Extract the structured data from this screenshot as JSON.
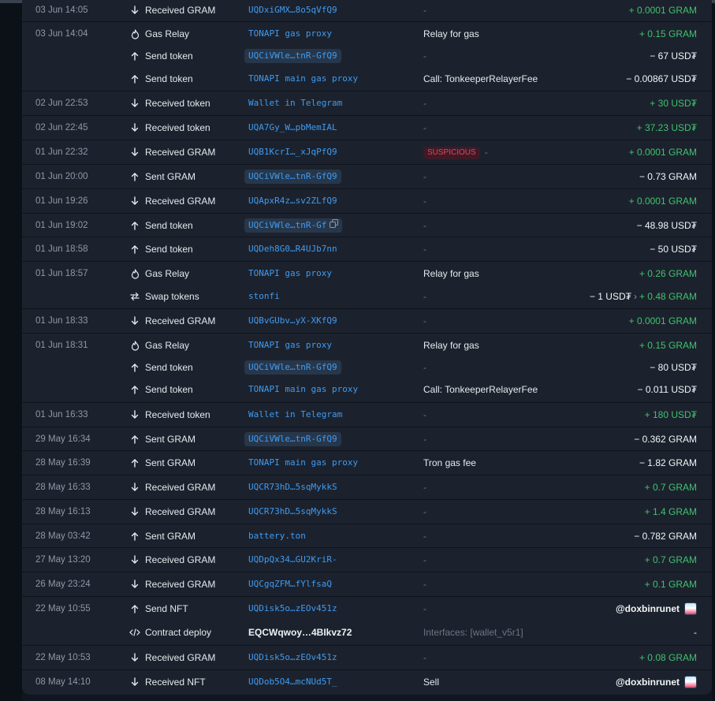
{
  "transactions": [
    {
      "date": "03 Jun 14:05",
      "icon": "arrow-down-icon",
      "type": "Received GRAM",
      "address": "UQDxiGMX…8o5qVfQ9",
      "addr_style": "plain",
      "description": "-",
      "amount": "+ 0.0001 GRAM",
      "amount_kind": "pos"
    },
    {
      "date": "03 Jun 14:04",
      "icon": "flame-icon",
      "type": "Gas Relay",
      "address": "TONAPI gas proxy",
      "addr_style": "plain",
      "description": "Relay for gas",
      "amount": "+ 0.15 GRAM",
      "amount_kind": "pos"
    },
    {
      "date": "",
      "icon": "arrow-up-icon",
      "type": "Send token",
      "address": "UQCiVWle…tnR-GfQ9",
      "addr_style": "pill",
      "description": "-",
      "amount": "− 67 USD₮",
      "amount_kind": "neg"
    },
    {
      "date": "",
      "icon": "arrow-up-icon",
      "type": "Send token",
      "address": "TONAPI main gas proxy",
      "addr_style": "plain",
      "description": "Call: TonkeeperRelayerFee",
      "amount": "− 0.00867 USD₮",
      "amount_kind": "neg"
    },
    {
      "date": "02 Jun 22:53",
      "icon": "arrow-down-icon",
      "type": "Received token",
      "address": "Wallet in Telegram",
      "addr_style": "plain",
      "description": "-",
      "amount": "+ 30 USD₮",
      "amount_kind": "pos"
    },
    {
      "date": "02 Jun 22:45",
      "icon": "arrow-down-icon",
      "type": "Received token",
      "address": "UQA7Gy_W…pbMemIAL",
      "addr_style": "plain",
      "description": "-",
      "amount": "+ 37.23 USD₮",
      "amount_kind": "pos"
    },
    {
      "date": "01 Jun 22:32",
      "icon": "arrow-down-icon",
      "type": "Received GRAM",
      "address": "UQB1KcrI…_xJqPfQ9",
      "addr_style": "plain",
      "description": "SUSPICIOUS",
      "desc_style": "badge",
      "amount": "+ 0.0001 GRAM",
      "amount_kind": "pos"
    },
    {
      "date": "01 Jun 20:00",
      "icon": "arrow-up-icon",
      "type": "Sent GRAM",
      "address": "UQCiVWle…tnR-GfQ9",
      "addr_style": "pill",
      "description": "-",
      "amount": "− 0.73 GRAM",
      "amount_kind": "neg"
    },
    {
      "date": "01 Jun 19:26",
      "icon": "arrow-down-icon",
      "type": "Received GRAM",
      "address": "UQApxR4z…sv2ZLfQ9",
      "addr_style": "plain",
      "description": "-",
      "amount": "+ 0.0001 GRAM",
      "amount_kind": "pos"
    },
    {
      "date": "01 Jun 19:02",
      "icon": "arrow-up-icon",
      "type": "Send token",
      "address": "UQCiVWle…tnR-Gf",
      "addr_style": "pill-copy",
      "description": "-",
      "amount": "− 48.98 USD₮",
      "amount_kind": "neg"
    },
    {
      "date": "01 Jun 18:58",
      "icon": "arrow-up-icon",
      "type": "Send token",
      "address": "UQDeh8G0…R4UJb7nn",
      "addr_style": "plain",
      "description": "-",
      "amount": "− 50 USD₮",
      "amount_kind": "neg"
    },
    {
      "date": "01 Jun 18:57",
      "icon": "flame-icon",
      "type": "Gas Relay",
      "address": "TONAPI gas proxy",
      "addr_style": "plain",
      "description": "Relay for gas",
      "amount": "+ 0.26 GRAM",
      "amount_kind": "pos"
    },
    {
      "date": "",
      "icon": "swap-icon",
      "type": "Swap tokens",
      "address": "stonfi",
      "addr_style": "plain",
      "description": "-",
      "amount_kind": "swap",
      "swap_out": "− 1 USD₮",
      "swap_in": "+ 0.48 GRAM"
    },
    {
      "date": "01 Jun 18:33",
      "icon": "arrow-down-icon",
      "type": "Received GRAM",
      "address": "UQBvGUbv…yX-XKfQ9",
      "addr_style": "plain",
      "description": "-",
      "amount": "+ 0.0001 GRAM",
      "amount_kind": "pos"
    },
    {
      "date": "01 Jun 18:31",
      "icon": "flame-icon",
      "type": "Gas Relay",
      "address": "TONAPI gas proxy",
      "addr_style": "plain",
      "description": "Relay for gas",
      "amount": "+ 0.15 GRAM",
      "amount_kind": "pos"
    },
    {
      "date": "",
      "icon": "arrow-up-icon",
      "type": "Send token",
      "address": "UQCiVWle…tnR-GfQ9",
      "addr_style": "pill",
      "description": "-",
      "amount": "− 80 USD₮",
      "amount_kind": "neg"
    },
    {
      "date": "",
      "icon": "arrow-up-icon",
      "type": "Send token",
      "address": "TONAPI main gas proxy",
      "addr_style": "plain",
      "description": "Call: TonkeeperRelayerFee",
      "amount": "− 0.011 USD₮",
      "amount_kind": "neg"
    },
    {
      "date": "01 Jun 16:33",
      "icon": "arrow-down-icon",
      "type": "Received token",
      "address": "Wallet in Telegram",
      "addr_style": "plain",
      "description": "-",
      "amount": "+ 180 USD₮",
      "amount_kind": "pos"
    },
    {
      "date": "29 May 16:34",
      "icon": "arrow-up-icon",
      "type": "Sent GRAM",
      "address": "UQCiVWle…tnR-GfQ9",
      "addr_style": "pill",
      "description": "-",
      "amount": "− 0.362 GRAM",
      "amount_kind": "neg"
    },
    {
      "date": "28 May 16:39",
      "icon": "arrow-up-icon",
      "type": "Sent GRAM",
      "address": "TONAPI main gas proxy",
      "addr_style": "plain",
      "description": "Tron gas fee",
      "amount": "− 1.82 GRAM",
      "amount_kind": "neg"
    },
    {
      "date": "28 May 16:33",
      "icon": "arrow-down-icon",
      "type": "Received GRAM",
      "address": "UQCR73hD…5sqMykkS",
      "addr_style": "plain",
      "description": "-",
      "amount": "+ 0.7 GRAM",
      "amount_kind": "pos"
    },
    {
      "date": "28 May 16:13",
      "icon": "arrow-down-icon",
      "type": "Received GRAM",
      "address": "UQCR73hD…5sqMykkS",
      "addr_style": "plain",
      "description": "-",
      "amount": "+ 1.4 GRAM",
      "amount_kind": "pos"
    },
    {
      "date": "28 May 03:42",
      "icon": "arrow-up-icon",
      "type": "Sent GRAM",
      "address": "battery.ton",
      "addr_style": "plain",
      "description": "-",
      "amount": "− 0.782 GRAM",
      "amount_kind": "neg"
    },
    {
      "date": "27 May 13:20",
      "icon": "arrow-down-icon",
      "type": "Received GRAM",
      "address": "UQDpQx34…GU2KriR-",
      "addr_style": "plain",
      "description": "-",
      "amount": "+ 0.7 GRAM",
      "amount_kind": "pos"
    },
    {
      "date": "26 May 23:24",
      "icon": "arrow-down-icon",
      "type": "Received GRAM",
      "address": "UQCgqZFM…fYlfsaQ",
      "addr_style": "plain",
      "description": "-",
      "amount": "+ 0.1 GRAM",
      "amount_kind": "pos"
    },
    {
      "date": "22 May 10:55",
      "icon": "arrow-up-icon",
      "type": "Send NFT",
      "address": "UQDisk5o…zEOv451z",
      "addr_style": "plain",
      "description": "-",
      "amount": "@doxbinrunet",
      "amount_kind": "nft"
    },
    {
      "date": "",
      "icon": "code-icon",
      "type": "Contract deploy",
      "address": "EQCWqwoy…4BIkvz72",
      "addr_style": "name",
      "description": "Interfaces: [wallet_v5r1]",
      "desc_style": "muted",
      "amount": "-",
      "amount_kind": "neg"
    },
    {
      "date": "22 May 10:53",
      "icon": "arrow-down-icon",
      "type": "Received GRAM",
      "address": "UQDisk5o…zEOv451z",
      "addr_style": "plain",
      "description": "-",
      "amount": "+ 0.08 GRAM",
      "amount_kind": "pos"
    },
    {
      "date": "08 May 14:10",
      "icon": "arrow-down-icon",
      "type": "Received NFT",
      "address": "UQDob5O4…mcNUd5T_",
      "addr_style": "plain",
      "description": "Sell",
      "amount": "@doxbinrunet",
      "amount_kind": "nft"
    }
  ]
}
